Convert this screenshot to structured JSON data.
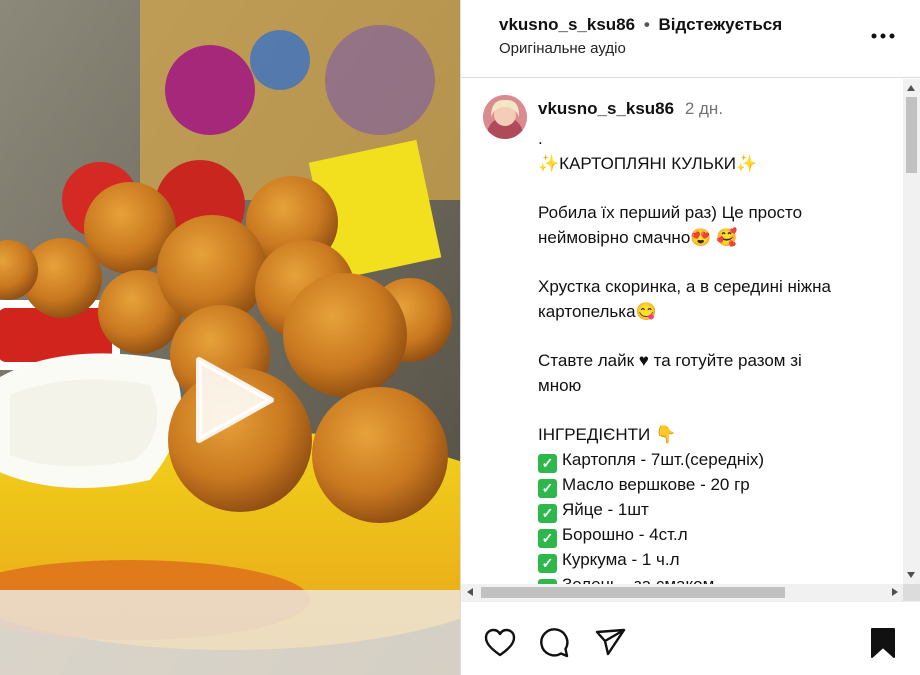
{
  "header": {
    "username": "vkusno_s_ksu86",
    "separator": "•",
    "follow_status": "Відстежується",
    "audio": "Оригінальне аудіо"
  },
  "post": {
    "username": "vkusno_s_ksu86",
    "time": "2 дн.",
    "caption_lines": [
      ".",
      "✨КАРТОПЛЯНІ КУЛЬКИ✨",
      "",
      "Робила їх перший раз) Це просто",
      "неймовірно смачно😍 🥰",
      "",
      "Хрустка скоринка, а в середині ніжна",
      "картопелька😋",
      "",
      "Ставте лайк ♥ та готуйте разом зі",
      "мною",
      "",
      "ІНГРЕДІЄНТИ 👇"
    ],
    "ingredients": [
      "Картопля - 7шт.(середніх)",
      "Масло вершкове - 20 гр",
      "Яйце - 1шт",
      "Борошно - 4ст.л",
      "Куркума - 1 ч.л",
      "Зелень - за смаком"
    ],
    "check_glyph": "✓"
  },
  "icons": {
    "play": "play-icon",
    "more": "more-options-icon",
    "like": "heart-icon",
    "comment": "comment-icon",
    "share": "share-icon",
    "save": "bookmark-icon"
  },
  "colors": {
    "check_green": "#2eb74a",
    "muted_text": "#737373",
    "border": "#dbdbdb"
  }
}
